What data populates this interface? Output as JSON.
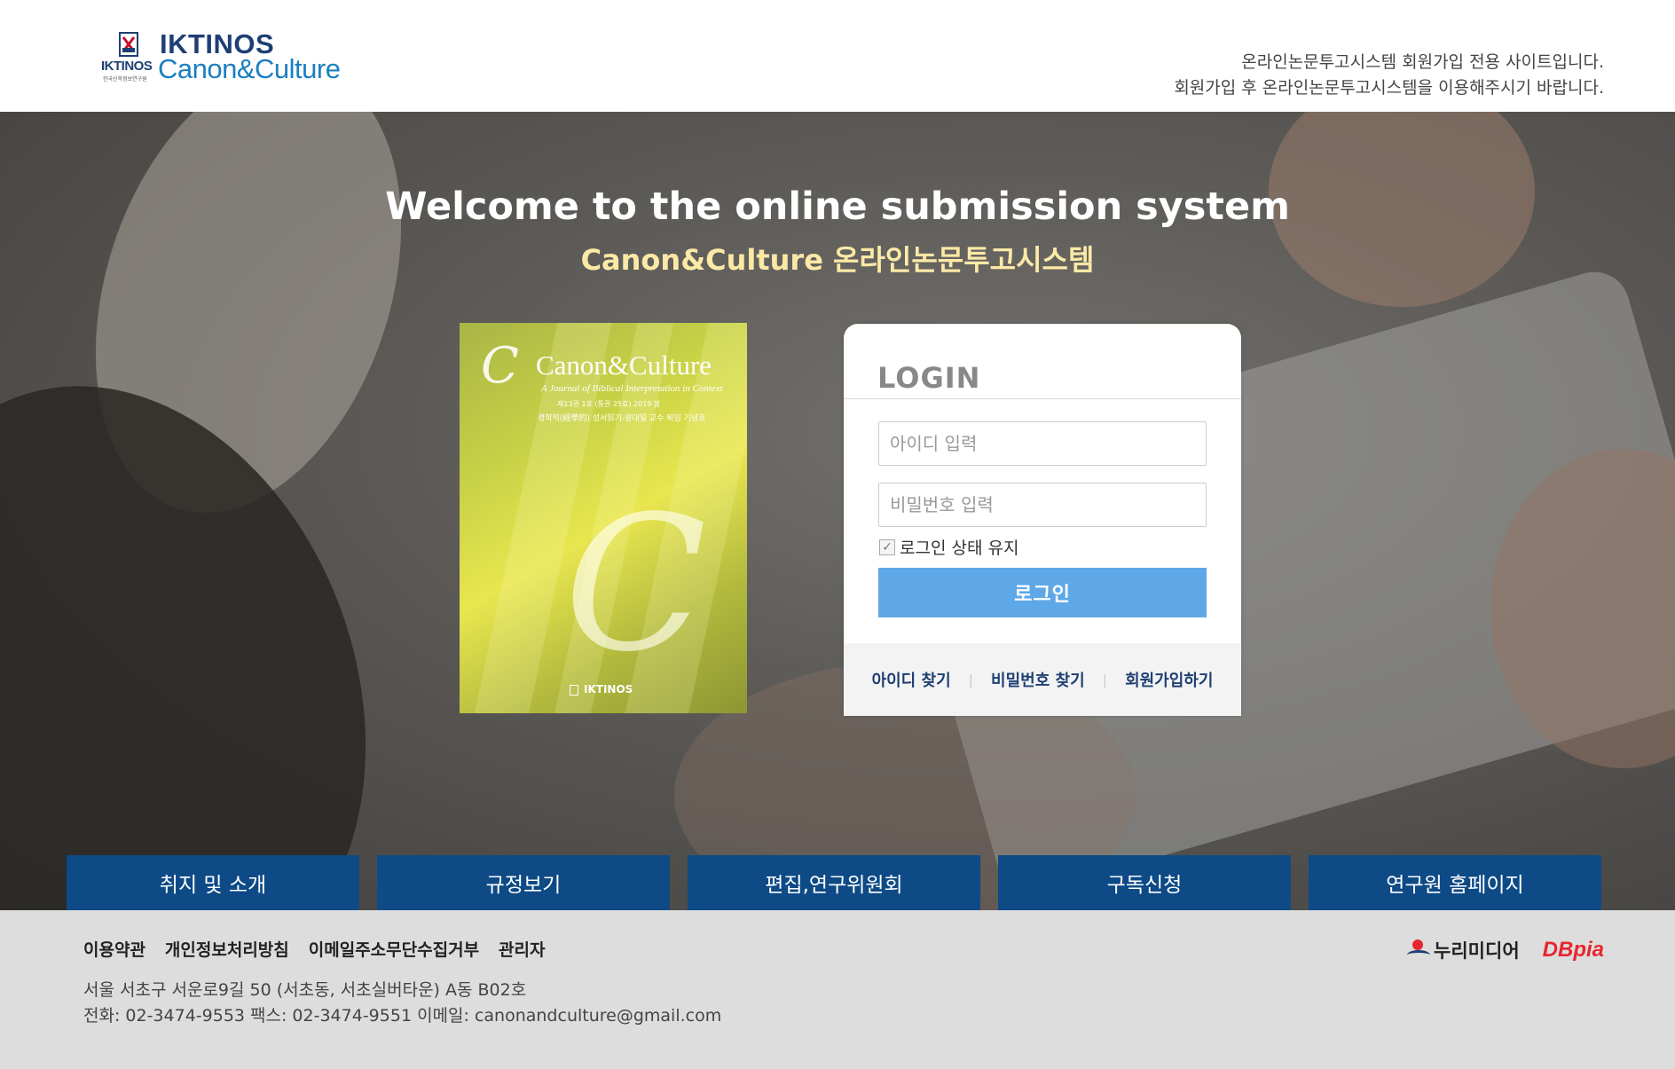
{
  "header": {
    "logo_small": "IKTINOS",
    "logo_tiny": "한국신학정보연구원",
    "logo_line1": "IKTINOS",
    "logo_line2": "Canon&Culture",
    "notice_line1": "온라인논문투고시스템 회원가입 전용 사이트입니다.",
    "notice_line2": "회원가입 후 온라인논문투고시스템을 이용해주시기 바랍니다."
  },
  "hero": {
    "welcome": "Welcome to the online submission system",
    "subtitle": "Canon&Culture 온라인논문투고시스템"
  },
  "cover": {
    "cc_mark": "C",
    "title": "Canon&Culture",
    "subtitle": "A Journal of Biblical Interpretation in Context",
    "issue": "제13권 1호 (통권 25호) 2019 봄",
    "theme": "경학적(經學的) 성서읽기-왕대일 교수 퇴임 기념호",
    "publisher": "IKTINOS"
  },
  "login": {
    "title": "LOGIN",
    "id_placeholder": "아이디 입력",
    "pw_placeholder": "비밀번호 입력",
    "keep_label": "로그인 상태 유지",
    "keep_checked": true,
    "button_label": "로그인",
    "links": {
      "find_id": "아이디 찾기",
      "find_pw": "비밀번호 찾기",
      "signup": "회원가입하기",
      "separator": "|"
    }
  },
  "nav": [
    {
      "label": "취지 및 소개"
    },
    {
      "label": "규정보기"
    },
    {
      "label": "편집,연구위원회"
    },
    {
      "label": "구독신청"
    },
    {
      "label": "연구원 홈페이지"
    }
  ],
  "footer": {
    "links": [
      "이용약관",
      "개인정보처리방침",
      "이메일주소무단수집거부",
      "관리자"
    ],
    "address": "서울 서초구 서운로9길 50 (서초동, 서초실버타운) A동 B02호",
    "contact": "전화: 02-3474-9553 팩스: 02-3474-9551 이메일: canonandculture@gmail.com",
    "partner1": "누리미디어",
    "partner2": "DBpia"
  },
  "colors": {
    "nav_bg": "#0d4a86",
    "login_button": "#5ea8e8",
    "subtitle": "#fbe9a6",
    "brand_navy": "#1f3f74",
    "brand_blue": "#1b7fc2",
    "dbpia_red": "#e8262f"
  },
  "icons": [
    "iktinos-emblem-icon",
    "nuri-media-logo-icon",
    "checkbox-check-icon"
  ]
}
